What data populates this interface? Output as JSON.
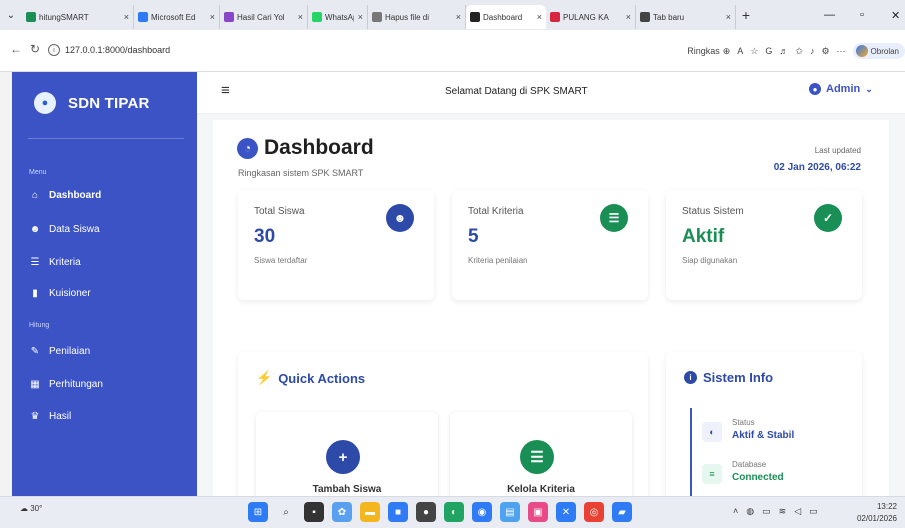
{
  "browser": {
    "tabs": [
      {
        "label": "hitungSMART",
        "color": "#1a8f55",
        "close": "×"
      },
      {
        "label": "Microsoft Ed",
        "color": "#2f7bf5",
        "close": "×"
      },
      {
        "label": "Hasil Cari Yol",
        "color": "#8a46c9",
        "close": "×"
      },
      {
        "label": "WhatsApp",
        "color": "#25d366",
        "close": "×"
      },
      {
        "label": "Hapus file di",
        "color": "#777777",
        "close": "×"
      },
      {
        "label": "Dashboard",
        "color": "#222222",
        "close": "×",
        "active": true
      },
      {
        "label": "PULANG KA",
        "color": "#d7263d",
        "close": "×"
      },
      {
        "label": "Tab baru",
        "color": "#444444",
        "close": "×"
      }
    ],
    "url": "127.0.0.1:8000/dashboard",
    "ringkas_label": "Ringkas",
    "profile_label": "Obrolan"
  },
  "sidebar": {
    "brand": "SDN TIPAR",
    "section_menu": "Menu",
    "section_hitung": "Hitung",
    "items": [
      {
        "label": "Dashboard",
        "icon": "home-icon"
      },
      {
        "label": "Data Siswa",
        "icon": "users-icon"
      },
      {
        "label": "Kriteria",
        "icon": "sliders-icon"
      },
      {
        "label": "Kuisioner",
        "icon": "clipboard-icon"
      },
      {
        "label": "Penilaian",
        "icon": "edit-icon"
      },
      {
        "label": "Perhitungan",
        "icon": "calculator-icon"
      },
      {
        "label": "Hasil",
        "icon": "trophy-icon"
      }
    ]
  },
  "topbar": {
    "welcome": "Selamat Datang di SPK SMART",
    "admin": "Admin"
  },
  "dashboard": {
    "title": "Dashboard",
    "subtitle": "Ringkasan sistem SPK SMART",
    "last_updated_label": "Last updated",
    "last_updated_value": "02 Jan 2026, 06:22"
  },
  "stats": [
    {
      "label": "Total Siswa",
      "value": "30",
      "desc": "Siswa terdaftar",
      "color": "#2e4aa8"
    },
    {
      "label": "Total Kriteria",
      "value": "5",
      "desc": "Kriteria penilaian",
      "color": "#1a8f55"
    },
    {
      "label": "Status Sistem",
      "value": "Aktif",
      "desc": "Siap digunakan",
      "color": "#1a8f55"
    }
  ],
  "quick_actions": {
    "title": "Quick Actions",
    "items": [
      {
        "label": "Tambah Siswa",
        "color": "#2e4aa8"
      },
      {
        "label": "Kelola Kriteria",
        "color": "#1a8f55"
      }
    ]
  },
  "system_info": {
    "title": "Sistem Info",
    "rows": [
      {
        "key": "Status",
        "value": "Aktif & Stabil",
        "color": "#2e4aa8"
      },
      {
        "key": "Database",
        "value": "Connected",
        "color": "#1a8f55"
      }
    ]
  },
  "taskbar": {
    "weather": "30°",
    "time": "13:22",
    "date": "02/01/2026"
  }
}
